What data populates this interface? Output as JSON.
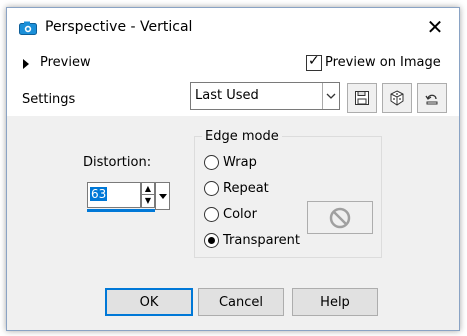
{
  "window": {
    "title": "Perspective - Vertical"
  },
  "preview": {
    "toggle_label": "Preview",
    "on_image_label": "Preview on Image",
    "on_image_checked": true
  },
  "settings": {
    "label": "Settings",
    "preset_value": "Last Used"
  },
  "distortion": {
    "label": "Distortion:",
    "value": "63"
  },
  "edge_mode": {
    "title": "Edge mode",
    "options": [
      {
        "label": "Wrap",
        "selected": false
      },
      {
        "label": "Repeat",
        "selected": false
      },
      {
        "label": "Color",
        "selected": false
      },
      {
        "label": "Transparent",
        "selected": true
      }
    ]
  },
  "buttons": {
    "ok": "OK",
    "cancel": "Cancel",
    "help": "Help"
  },
  "icons": {
    "app": "camera-icon",
    "close": "close-icon",
    "save": "save-icon",
    "randomize": "dice-icon",
    "reset": "reset-icon",
    "no_color": "no-color-icon"
  },
  "colors": {
    "accent": "#0078d7",
    "panel": "#f0f0f0"
  }
}
